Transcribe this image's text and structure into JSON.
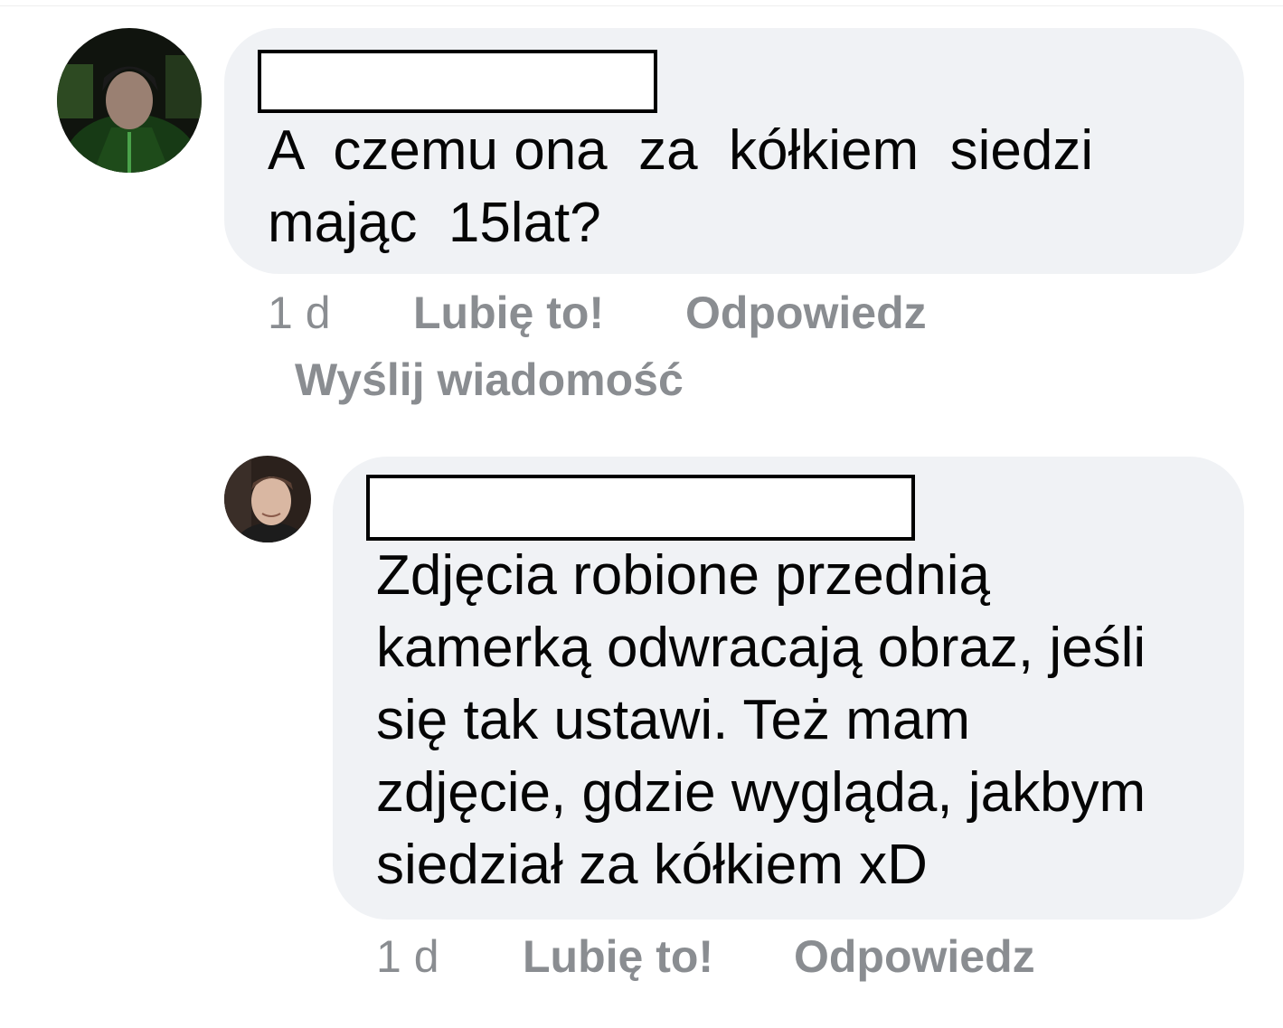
{
  "comments": [
    {
      "text_lines": [
        "A  czemu ona  za  kółkiem  siedzi",
        "mając  15lat?"
      ],
      "time": "1 d",
      "like_label": "Lubię to!",
      "reply_label": "Odpowiedz",
      "message_label": "Wyślij wiadomość"
    },
    {
      "text_lines": [
        "Zdjęcia robione przednią",
        "kamerką odwracają obraz, jeśli",
        "się tak ustawi. Też mam",
        "zdjęcie, gdzie wygląda, jakbym",
        "siedział za kółkiem xD"
      ],
      "time": "1 d",
      "like_label": "Lubię to!",
      "reply_label": "Odpowiedz"
    }
  ],
  "colors": {
    "bubble": "#f0f2f5",
    "text": "#050505",
    "meta": "#8a8d91"
  },
  "icons": [
    "avatar-photo-1",
    "avatar-photo-2"
  ]
}
